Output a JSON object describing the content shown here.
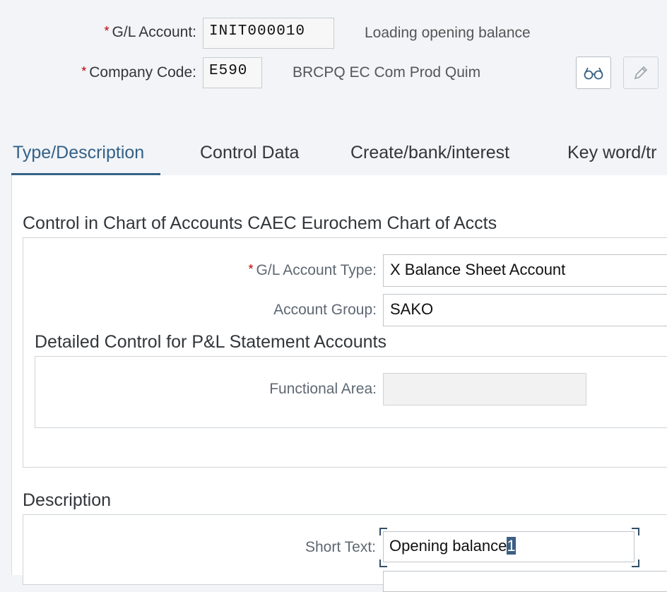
{
  "header": {
    "gl_account_label": "G/L Account:",
    "gl_account_value": "INIT000010",
    "gl_account_desc": "Loading opening balance",
    "company_code_label": "Company Code:",
    "company_code_value": "E590",
    "company_code_desc": "BRCPQ EC Com Prod Quim",
    "required_marker": "*",
    "display_icon": "glasses-icon",
    "edit_icon": "pencil-icon"
  },
  "tabs": [
    {
      "label": "Type/Description",
      "active": true
    },
    {
      "label": "Control Data",
      "active": false
    },
    {
      "label": "Create/bank/interest",
      "active": false
    },
    {
      "label": "Key word/tr",
      "active": false
    }
  ],
  "control_section": {
    "title": "Control in Chart of Accounts CAEC Eurochem Chart of Accts",
    "account_type_label": "G/L Account Type:",
    "account_type_value": "X Balance Sheet Account",
    "account_group_label": "Account Group:",
    "account_group_value": "SAKO",
    "pl_title": "Detailed Control for P&L Statement Accounts",
    "functional_area_label": "Functional Area:",
    "functional_area_value": ""
  },
  "description_section": {
    "title": "Description",
    "short_text_label": "Short Text:",
    "short_text_value": "Opening balance",
    "short_text_selected": "1"
  },
  "colors": {
    "accent": "#346187",
    "required": "#bb0000",
    "background": "#f2f4f7"
  }
}
